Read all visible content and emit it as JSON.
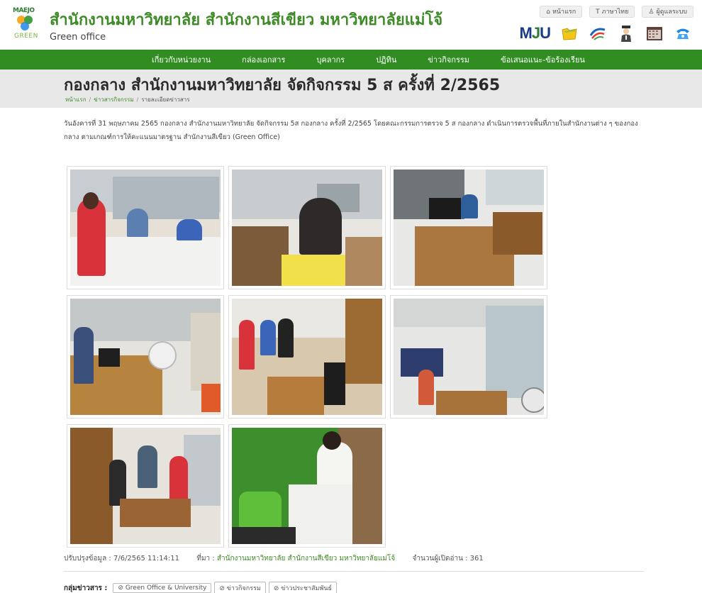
{
  "header": {
    "logo_top": "MAEJO",
    "logo_bottom": "GREEN",
    "title": "สำนักงานมหาวิทยาลัย สำนักงานสีเขียว มหาวิทยาลัยแม่โจ้",
    "subtitle": "Green office",
    "toplinks": [
      {
        "icon": "⌂",
        "label": "หน้าแรก"
      },
      {
        "icon": "T",
        "label": "ภาษาไทย"
      },
      {
        "icon": "♙",
        "label": "ผู้ดูแลระบบ"
      }
    ],
    "mju_m": "M",
    "mju_j": "J",
    "mju_u": "U"
  },
  "nav": {
    "items": [
      "เกี่ยวกับหน่วยงาน",
      "กล่องเอกสาร",
      "บุคลากร",
      "ปฏิทิน",
      "ข่าวกิจกรรม",
      "ข้อเสนอแนะ-ข้อร้องเรียน"
    ]
  },
  "page": {
    "title": "กองกลาง สำนักงานมหาวิทยาลัย จัดกิจกรรม 5 ส ครั้งที่ 2/2565",
    "breadcrumb": [
      "หน้าแรก",
      "ข่าวสารกิจกรรม",
      "รายละเอียดข่าวสาร"
    ],
    "description": "วันอังคารที่ 31 พฤษภาคม 2565 กองกลาง สำนักงานมหาวิทยาลัย จัดกิจกรรม 5ส กองกลาง ครั้งที่ 2/2565 โดยคณะกรรมการตรวจ 5 ส กองกลาง ดำเนินการตรวจพื้นที่ภายในสำนักงานต่าง ๆ ของกองกลาง ตามเกณฑ์การให้คะแนนมาตรฐาน สำนักงานสีเขียว (Green Office)"
  },
  "meta": {
    "updated_label": "ปรับปรุงข้อมูล :",
    "updated_value": "7/6/2565 11:14:11",
    "source_label": "ที่มา :",
    "source_value": "สำนักงานมหาวิทยาลัย สำนักงานสีเขียว มหาวิทยาลัยแม่โจ้",
    "views_label": "จำนวนผู้เปิดอ่าน :",
    "views_value": "361"
  },
  "tags": {
    "label": "กลุ่มข่าวสาร :",
    "items": [
      "Green Office & University",
      "ข่าวกิจกรรม",
      "ข่าวประชาสัมพันธ์"
    ]
  },
  "colors": {
    "brand_green": "#318d22",
    "title_green": "#3d8b26",
    "band_gray": "#e8e8e8"
  }
}
